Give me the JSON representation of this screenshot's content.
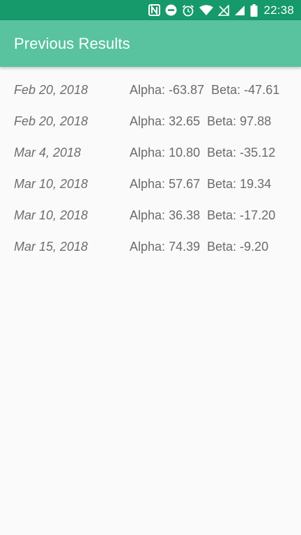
{
  "status_bar": {
    "time": "22:38",
    "icons": [
      "nfc-icon",
      "do-not-disturb-icon",
      "alarm-icon",
      "wifi-icon",
      "no-signal-icon",
      "cell-signal-icon",
      "battery-icon"
    ]
  },
  "app_bar": {
    "title": "Previous Results"
  },
  "results": [
    {
      "date": "Feb 20, 2018",
      "alpha": "-63.87",
      "beta": "-47.61"
    },
    {
      "date": "Feb 20, 2018",
      "alpha": "32.65",
      "beta": "97.88"
    },
    {
      "date": "Mar 4, 2018",
      "alpha": "10.80",
      "beta": "-35.12"
    },
    {
      "date": "Mar 10, 2018",
      "alpha": "57.67",
      "beta": "19.34"
    },
    {
      "date": "Mar 10, 2018",
      "alpha": "36.38",
      "beta": "-17.20"
    },
    {
      "date": "Mar 15, 2018",
      "alpha": "74.39",
      "beta": "-9.20"
    }
  ],
  "labels": {
    "alpha": "Alpha:",
    "beta": "Beta:"
  },
  "colors": {
    "status_bar": "#16996b",
    "app_bar": "#58c39e",
    "background": "#fafafa",
    "text": "#6b6b6b"
  }
}
